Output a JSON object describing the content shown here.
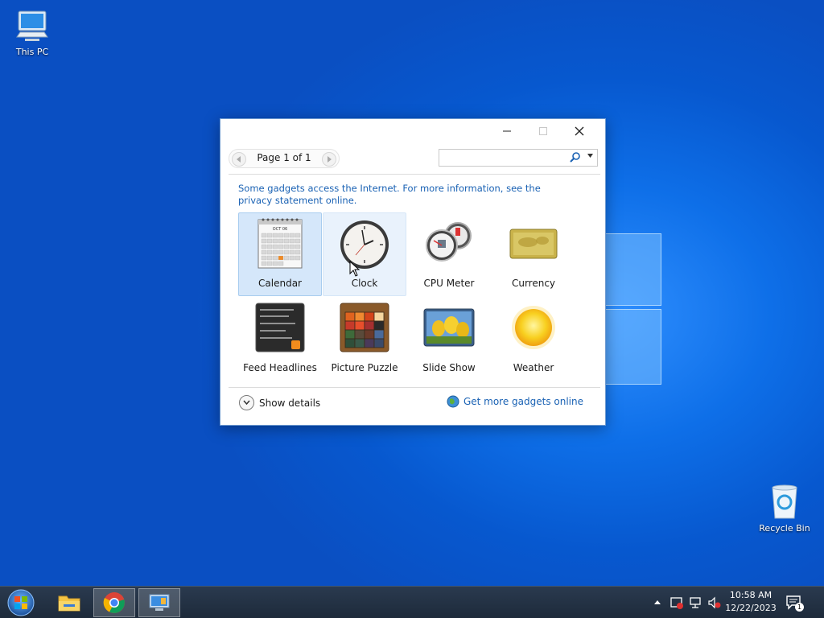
{
  "desktop": {
    "icons": [
      {
        "label": "This PC"
      },
      {
        "label": "Recycle Bin"
      }
    ]
  },
  "gadget_window": {
    "pager": {
      "label": "Page 1 of 1"
    },
    "search": {
      "value": "",
      "placeholder": ""
    },
    "notice": "Some gadgets access the Internet.  For more information, see the privacy statement online.",
    "gadgets": [
      {
        "label": "Calendar",
        "icon": "calendar-icon",
        "calendar_month": "OCT 06"
      },
      {
        "label": "Clock",
        "icon": "clock-icon"
      },
      {
        "label": "CPU Meter",
        "icon": "cpu-meter-icon"
      },
      {
        "label": "Currency",
        "icon": "currency-icon"
      },
      {
        "label": "Feed Headlines",
        "icon": "feed-headlines-icon"
      },
      {
        "label": "Picture Puzzle",
        "icon": "picture-puzzle-icon"
      },
      {
        "label": "Slide Show",
        "icon": "slide-show-icon"
      },
      {
        "label": "Weather",
        "icon": "weather-icon"
      }
    ],
    "show_details": "Show details",
    "get_more": "Get more gadgets online"
  },
  "taskbar": {
    "clock": {
      "time": "10:58 AM",
      "date": "12/22/2023"
    },
    "notification_count": "1"
  },
  "colors": {
    "link": "#1a62b4",
    "selection": "#d5e7fa",
    "taskbar": "#1d2a3a"
  }
}
